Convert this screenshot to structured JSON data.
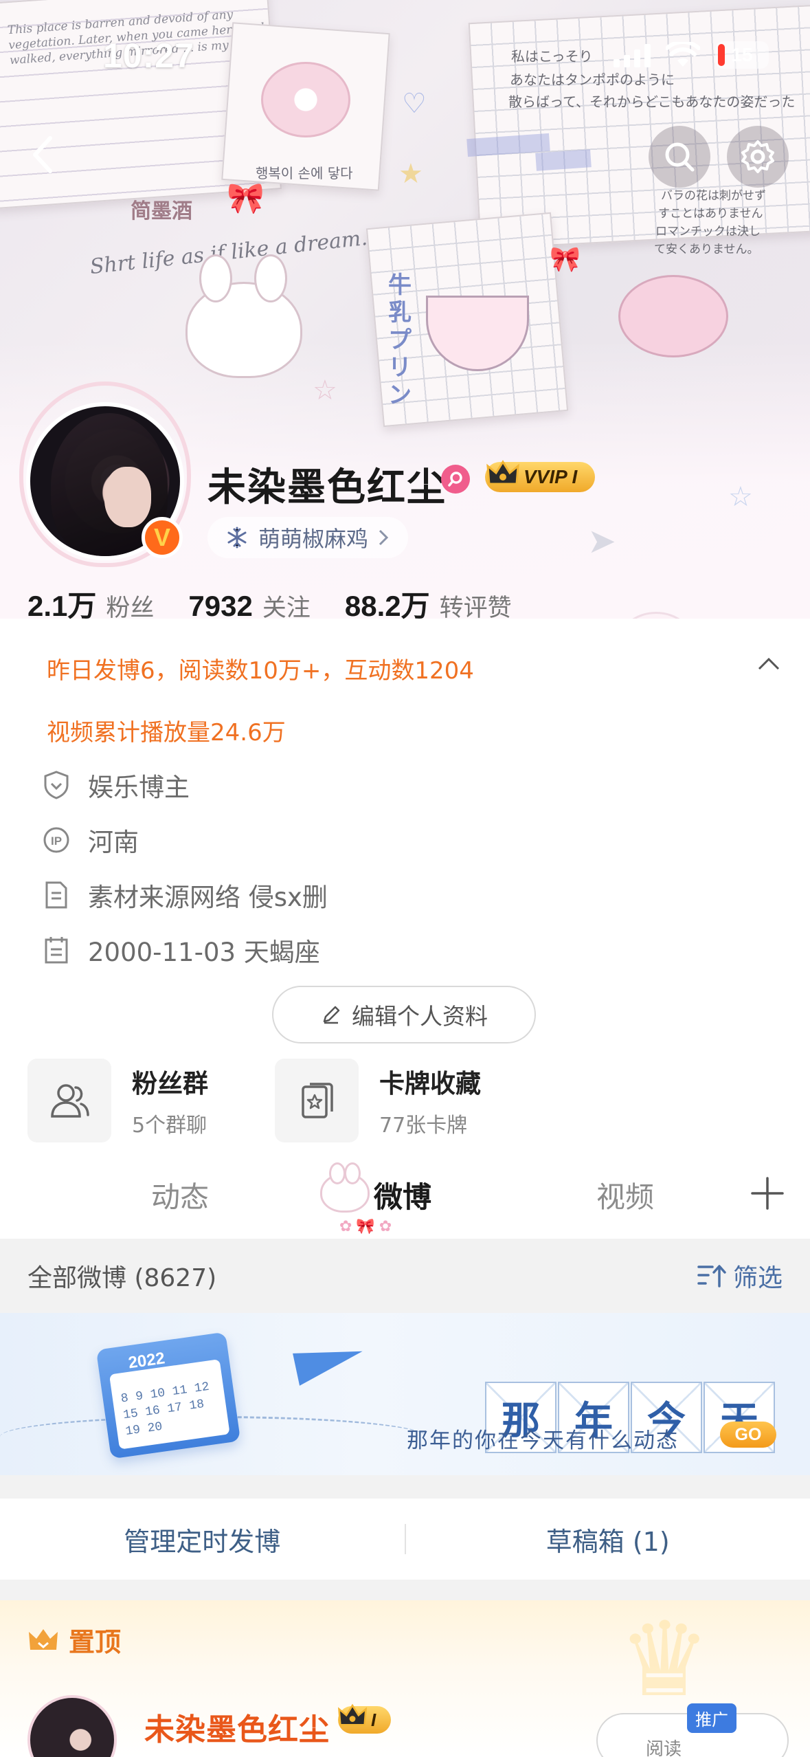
{
  "status_bar": {
    "time": "10:27",
    "battery": "15"
  },
  "header_art": {
    "note_en": "This place is barren and devoid of any vegetation. Later, when you came here and walked, everything mirrored ... is my",
    "note_jp_1": "私はこっそり",
    "note_jp_2": "あなたはタンポポのように",
    "note_jp_3": "散らばって、それからどこもあなたの姿だった",
    "note_jp_4": "バラの花は刺がせず",
    "note_jp_5": "すことはありません",
    "note_jp_6": "ロマンチックは決し",
    "note_jp_7": "て安くありません。",
    "note_kr": "행복이 손에 닿다",
    "note_cn": "简墨酒",
    "slogan": "Shrt life as if like a dream.",
    "pudding": "牛乳プリン"
  },
  "profile": {
    "name": "未染墨色红尘",
    "vip_label": "VVIP I",
    "verified_mark": "V",
    "group_name": "萌萌椒麻鸡",
    "stats": [
      {
        "num": "2.1万",
        "label": "粉丝"
      },
      {
        "num": "7932",
        "label": "关注"
      },
      {
        "num": "88.2万",
        "label": "转评赞"
      }
    ],
    "activity_line1": "昨日发博6，阅读数10万+，互动数1204",
    "activity_line2": "视频累计播放量24.6万",
    "info": {
      "category": "娱乐博主",
      "location": "河南",
      "bio": "素材来源网络 侵sx删",
      "birthday": "2000-11-03 天蝎座"
    },
    "edit_button": "编辑个人资料"
  },
  "cards": [
    {
      "title": "粉丝群",
      "subtitle": "5个群聊"
    },
    {
      "title": "卡牌收藏",
      "subtitle": "77张卡牌"
    }
  ],
  "tabs": [
    {
      "label": "动态"
    },
    {
      "label": "微博"
    },
    {
      "label": "视频"
    }
  ],
  "filter_bar": {
    "label": "全部微博 (8627)",
    "filter": "筛选"
  },
  "banner": {
    "calendar_year": "2022",
    "calendar_digits": "8 9 10 11 12 15 16 17 18 19 20",
    "title_chars": [
      "那",
      "年",
      "今",
      "天"
    ],
    "subtitle": "那年的你在今天有什么动态",
    "go": "GO"
  },
  "manage": {
    "scheduled": "管理定时发博",
    "drafts": "草稿箱 (1)"
  },
  "pinned": {
    "label": "置顶",
    "name": "未染墨色红尘",
    "vip_label": "I",
    "promo_tag": "推广",
    "promo_text": "阅读"
  },
  "colors": {
    "orange": "#f07122",
    "link_blue": "#3e5f86",
    "vip_gold": "#f0a92a"
  }
}
